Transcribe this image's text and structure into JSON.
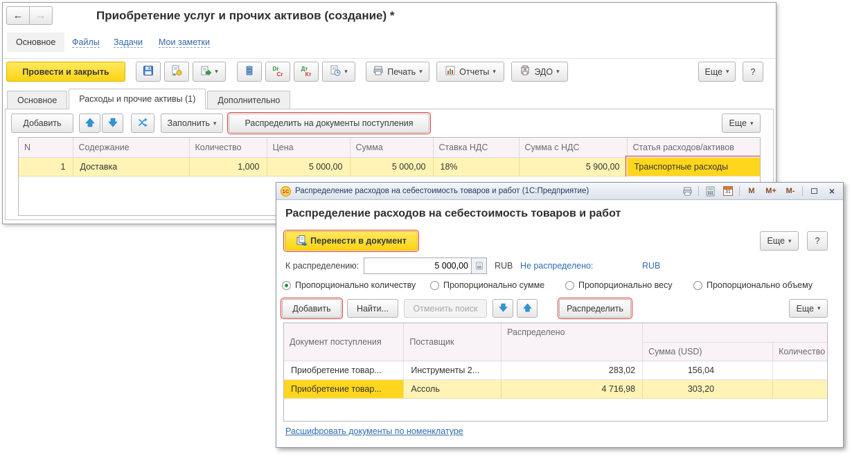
{
  "icons": {
    "back": "←",
    "forward": "→",
    "caret": "▾",
    "close": "×"
  },
  "main_window": {
    "title": "Приобретение услуг и прочих активов (создание) *",
    "nav": {
      "current": "Основное",
      "links": [
        "Файлы",
        "Задачи",
        "Мои заметки"
      ]
    },
    "toolbar": {
      "post_and_close": "Провести и закрыть",
      "print": "Печать",
      "reports": "Отчеты",
      "edo": "ЭДО",
      "more": "Еще",
      "help": "?",
      "drcr_top": "Dr",
      "drcr_bottom": "Cr",
      "dtkt_top": "Дт",
      "dtkt_bottom": "Кт"
    },
    "tabs": [
      {
        "label": "Основное"
      },
      {
        "label": "Расходы и прочие активы (1)"
      },
      {
        "label": "Дополнительно"
      }
    ],
    "grid_toolbar": {
      "add": "Добавить",
      "fill": "Заполнить",
      "distribute": "Распределить на документы поступления",
      "more": "Еще"
    },
    "grid": {
      "columns": [
        "N",
        "Содержание",
        "Количество",
        "Цена",
        "Сумма",
        "Ставка НДС",
        "Сумма с НДС",
        "Статья расходов/активов"
      ],
      "rows": [
        [
          "1",
          "Доставка",
          "1,000",
          "5 000,00",
          "5 000,00",
          "18%",
          "5 900,00",
          "Транспортные расходы"
        ]
      ]
    }
  },
  "dialog": {
    "titlebar": {
      "logo": "1С",
      "title": "Распределение расходов на себестоимость товаров и работ  (1С:Предприятие)",
      "calendar_day": "31",
      "memory_buttons": [
        "M",
        "M+",
        "M-"
      ]
    },
    "heading": "Распределение расходов на себестоимость товаров и работ",
    "actions": {
      "transfer": "Перенести в документ",
      "more": "Еще",
      "help": "?"
    },
    "amount": {
      "label": "К распределению:",
      "value": "5 000,00",
      "currency": "RUB",
      "not_distributed_label": "Не распределено:",
      "not_distributed_currency": "RUB"
    },
    "radios": [
      {
        "label": "Пропорционально количеству",
        "selected": true
      },
      {
        "label": "Пропорционально сумме",
        "selected": false
      },
      {
        "label": "Пропорционально весу",
        "selected": false
      },
      {
        "label": "Пропорционально объему",
        "selected": false
      }
    ],
    "grid_toolbar": {
      "add": "Добавить",
      "find": "Найти...",
      "cancel_search": "Отменить поиск",
      "distribute": "Распределить",
      "more": "Еще"
    },
    "grid": {
      "columns": {
        "doc": "Документ поступления",
        "supplier": "Поставщик",
        "distributed": "Распределено",
        "sum_usd": "Сумма (USD)",
        "qty": "Количество"
      },
      "rows": [
        [
          "Приобретение товар...",
          "Инструменты 2...",
          "283,02",
          "156,04",
          ""
        ],
        [
          "Приобретение товар...",
          "Ассоль",
          "4 716,98",
          "303,20",
          ""
        ]
      ]
    },
    "footer_link": "Расшифровать документы по номенклатуре"
  }
}
